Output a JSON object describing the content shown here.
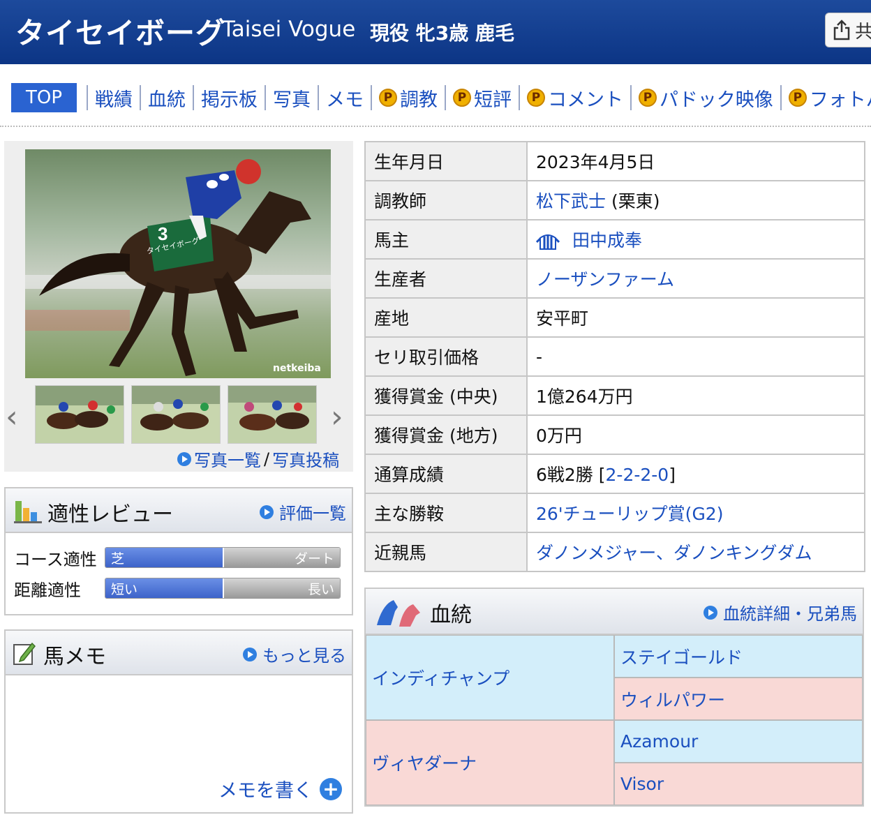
{
  "header": {
    "name_jp": "タイセイボーグ",
    "name_en": "Taisei Vogue",
    "status": "現役 牝3歳 鹿毛",
    "share_label": "共"
  },
  "tabs": {
    "active": "TOP",
    "items": [
      "戦績",
      "血統",
      "掲示板",
      "写真",
      "メモ",
      "調教",
      "短評",
      "コメント",
      "パドック映像",
      "フォトパ"
    ],
    "premium_badge": "P"
  },
  "photo": {
    "watermark": "netkeiba",
    "saddle_number": "3",
    "saddle_name": "タイセイボーグ",
    "link_list": "写真一覧",
    "separator": "/",
    "link_post": "写真投稿"
  },
  "aptitude": {
    "title": "適性レビュー",
    "more": "評価一覧",
    "course": {
      "label": "コース適性",
      "left": "芝",
      "right": "ダート",
      "value": 0.5
    },
    "distance": {
      "label": "距離適性",
      "left": "短い",
      "right": "長い",
      "value": 0.5
    }
  },
  "memo": {
    "title": "馬メモ",
    "more": "もっと見る",
    "write": "メモを書く"
  },
  "profile": {
    "birthdate": {
      "label": "生年月日",
      "value": "2023年4月5日"
    },
    "trainer": {
      "label": "調教師",
      "name": "松下武士",
      "suffix": "(栗東)"
    },
    "owner": {
      "label": "馬主",
      "name": "田中成奉"
    },
    "breeder": {
      "label": "生産者",
      "name": "ノーザンファーム"
    },
    "birthplace": {
      "label": "産地",
      "value": "安平町"
    },
    "auction": {
      "label": "セリ取引価格",
      "value": "-"
    },
    "earnings_central": {
      "label": "獲得賞金 (中央)",
      "value": "1億264万円"
    },
    "earnings_local": {
      "label": "獲得賞金 (地方)",
      "value": "0万円"
    },
    "record": {
      "label": "通算成績",
      "text": "6戦2勝 [",
      "link": "2-2-2-0",
      "close": "]"
    },
    "major_wins": {
      "label": "主な勝鞍",
      "value": "26'チューリップ賞(G2)"
    },
    "relatives": {
      "label": "近親馬",
      "value": "ダノンメジャー、ダノンキングダム"
    }
  },
  "pedigree": {
    "title": "血統",
    "more": "血統詳細・兄弟馬",
    "sire": "インディチャンプ",
    "sire_sire": "ステイゴールド",
    "sire_dam": "ウィルパワー",
    "dam": "ヴィヤダーナ",
    "dam_sire": "Azamour",
    "dam_dam": "Visor"
  },
  "colors": {
    "header": "#0c3585",
    "link": "#1a4fbf",
    "tab_active": "#2a63d1",
    "male_cell": "#d3eefa",
    "female_cell": "#f9d9d6"
  }
}
